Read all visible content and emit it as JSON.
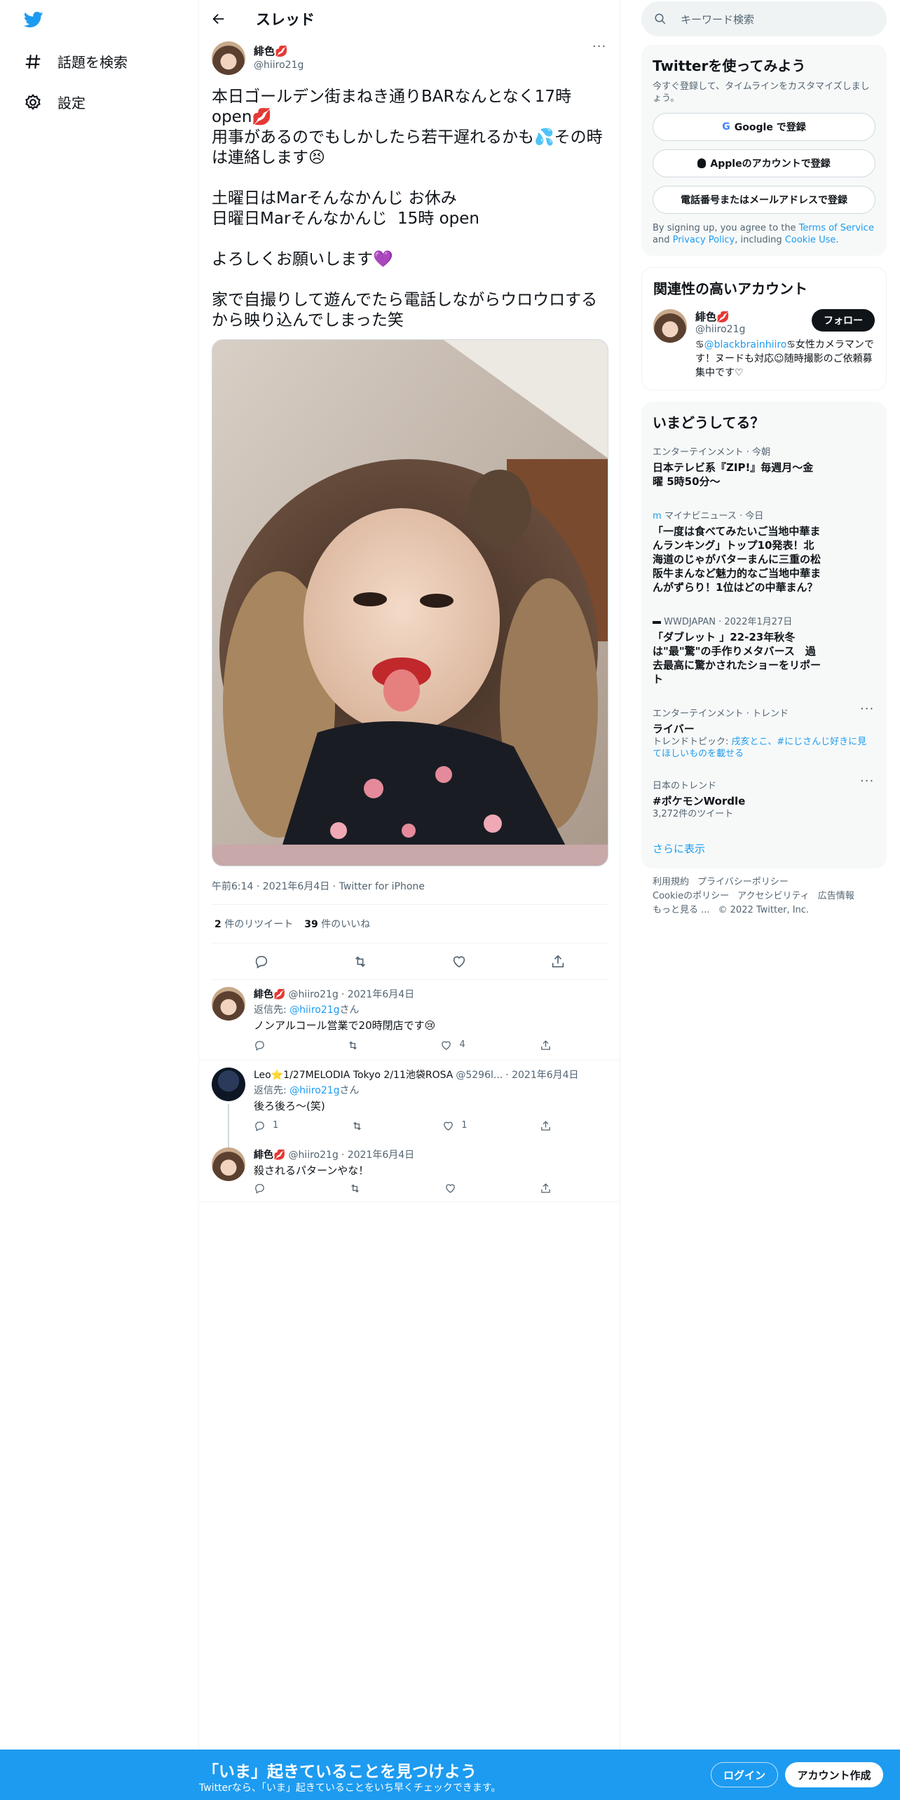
{
  "nav": {
    "search_label": "話題を検索",
    "settings_label": "設定"
  },
  "header": {
    "title": "スレッド"
  },
  "tweet": {
    "name": "緋色💋",
    "handle": "@hiiro21g",
    "text": "本日ゴールデン街まねき通りBARなんとなく17時open💋\n用事があるのでもしかしたら若干遅れるかも💦その時は連絡します😣\n\n土曜日はMarそんなかんじ お休み\n日曜日Marそんなかんじ  15時 open\n\nよろしくお願いします💜\n\n家で自撮りして遊んでたら電話しながらウロウロするから映り込んでしまった笑",
    "meta": "午前6:14 · 2021年6月4日 · Twitter for iPhone",
    "retweets": "2",
    "retweets_label": "件のリツイート",
    "likes": "39",
    "likes_label": "件のいいね"
  },
  "replies": [
    {
      "name": "緋色💋",
      "handle": "@hiiro21g",
      "date": "· 2021年6月4日",
      "reply_to_prefix": "返信先: ",
      "reply_to": "@hiiro21g",
      "reply_to_suffix": "さん",
      "text": "ノンアルコール営業で20時閉店です😢",
      "reply_count": "",
      "retweet_count": "",
      "like_count": "4"
    },
    {
      "name": "Leo⭐1/27MELODIA Tokyo 2/11池袋ROSA",
      "handle": "@5296l...",
      "date": "· 2021年6月4日",
      "reply_to_prefix": "返信先: ",
      "reply_to": "@hiiro21g",
      "reply_to_suffix": "さん",
      "text": "後ろ後ろ～(笑)",
      "reply_count": "1",
      "retweet_count": "",
      "like_count": "1"
    },
    {
      "name": "緋色💋",
      "handle": "@hiiro21g",
      "date": "· 2021年6月4日",
      "text": "殺されるパターンやな！",
      "reply_count": "",
      "retweet_count": "",
      "like_count": ""
    }
  ],
  "search": {
    "placeholder": "キーワード検索"
  },
  "signup": {
    "title": "Twitterを使ってみよう",
    "subtitle": "今すぐ登録して、タイムラインをカスタマイズしましょう。",
    "google": "Google で登録",
    "apple": "Appleのアカウントで登録",
    "phone": "電話番号またはメールアドレスで登録",
    "tos_1": "By signing up, you agree to the ",
    "tos_terms": "Terms of Service",
    "tos_2": " and ",
    "tos_privacy": "Privacy Policy",
    "tos_3": ", including ",
    "tos_cookie": "Cookie Use",
    "tos_4": "."
  },
  "related": {
    "title": "関連性の高いアカウント",
    "name": "緋色💋",
    "handle": "@hiiro21g",
    "follow": "フォロー",
    "bio_1": "♋",
    "bio_link": "@blackbrainhiiro",
    "bio_2": "♋女性カメラマンです！ヌードも対応☺随時撮影のご依頼募集中です♡"
  },
  "trends": {
    "title": "いまどうしてる？",
    "items": [
      {
        "context": "エンターテインメント · 今朝",
        "text": "日本テレビ系『ZIP!』毎週月〜金曜 5時50分〜"
      },
      {
        "context": "マイナビニュース · 今日",
        "text": "「一度は食べてみたいご当地中華まんランキング」トップ10発表！北海道のじゃがバターまんに三重の松阪牛まんなど魅力的なご当地中華まんがずらり！1位はどの中華まん？"
      },
      {
        "context": "WWDJAPAN · 2022年1月27日",
        "text": "「ダブレット 」22-23年秋冬は\"最\"驚\"の手作りメタバース　過去最高に驚かされたショーをリポート"
      },
      {
        "context": "エンターテインメント · トレンド",
        "text": "ライバー",
        "extra_prefix": "トレンドトピック: ",
        "extra": "戌亥とこ、#にじさんじ好きに見てほしいものを載せる"
      },
      {
        "context": "日本のトレンド",
        "text": "#ポケモンWordle",
        "extra_plain": "3,272件のツイート"
      }
    ],
    "show_more": "さらに表示"
  },
  "footer": {
    "l1": "利用規約",
    "l2": "プライバシーポリシー",
    "l3": "Cookieのポリシー",
    "l4": "アクセシビリティ",
    "l5": "広告情報",
    "l6": "もっと見る ...",
    "l7": "© 2022 Twitter, Inc."
  },
  "bottom": {
    "heading": "「いま」起きていることを見つけよう",
    "sub": "Twitterなら、「いま」起きていることをいち早くチェックできます。",
    "login": "ログイン",
    "signup": "アカウント作成"
  },
  "colors": {
    "accent": "#1d9bf0",
    "text": "#0f1419",
    "muted": "#536471"
  }
}
